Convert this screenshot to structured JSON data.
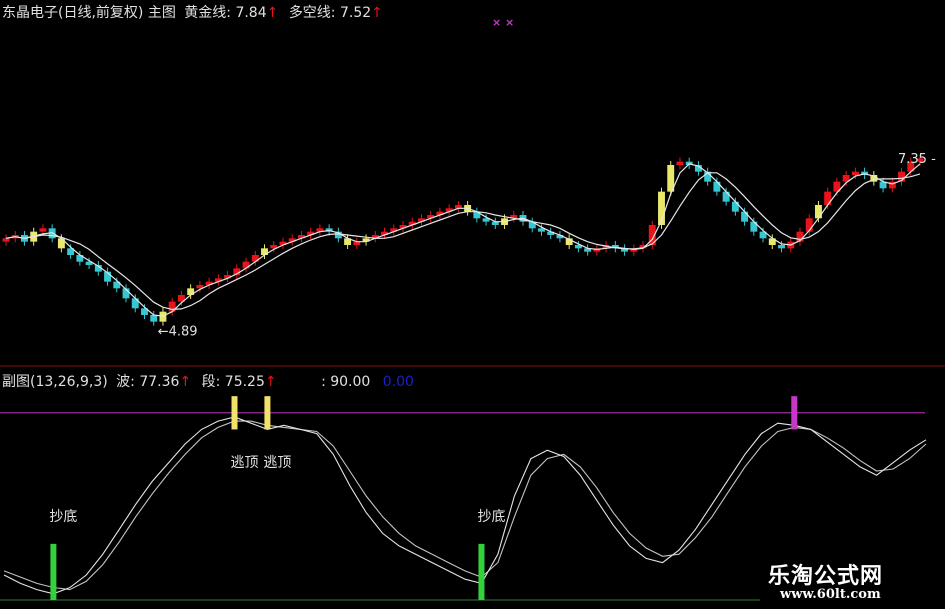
{
  "main_header": {
    "title": "东晶电子(日线,前复权)",
    "label": "主图",
    "gold_line_label": "黄金线:",
    "gold_line_value": "7.84",
    "longshort_label": "多空线:",
    "longshort_value": "7.52",
    "arrow": "↑"
  },
  "sub_header": {
    "title": "副图(13,26,9,3)",
    "wave_label": "波:",
    "wave_value": "77.36",
    "segment_label": "段:",
    "segment_value": "75.25",
    "level_text": ": 90.00",
    "blue_value": "0.00",
    "arrow": "↑"
  },
  "annotations": {
    "low_price": "4.89",
    "high_price": "7.35",
    "bottom_buy": "抄底",
    "escape_top": "逃顶"
  },
  "watermark": {
    "name": "乐淘公式网",
    "url": "www.60lt.com"
  },
  "colors": {
    "up": "#e8141a",
    "down": "#35c7d3",
    "neutral_yellow": "#e8e86a",
    "signal_buy": "#35d13a",
    "signal_sell": "#f2e26a",
    "signal_magenta": "#c838c8",
    "level_line": "#b030b0",
    "divider": "#8a1010",
    "curve": "#e6e6e6",
    "arrow": "#e8141a",
    "blue": "#1a20c8"
  },
  "chart_data": [
    {
      "type": "candlestick",
      "title": "东晶电子(日线,前复权)",
      "y_marks": {
        "low": 4.89,
        "high": 7.35
      },
      "series": [
        {
          "name": "黄金线",
          "last": 7.84
        },
        {
          "name": "多空线",
          "last": 7.52
        }
      ],
      "closes": [
        6.2,
        6.25,
        6.15,
        6.3,
        6.35,
        6.2,
        6.05,
        5.95,
        5.85,
        5.8,
        5.7,
        5.55,
        5.45,
        5.3,
        5.15,
        5.05,
        4.95,
        5.1,
        5.25,
        5.35,
        5.45,
        5.5,
        5.55,
        5.6,
        5.65,
        5.75,
        5.85,
        5.95,
        6.05,
        6.1,
        6.15,
        6.2,
        6.25,
        6.3,
        6.35,
        6.3,
        6.2,
        6.1,
        6.15,
        6.2,
        6.25,
        6.3,
        6.35,
        6.4,
        6.45,
        6.5,
        6.55,
        6.6,
        6.65,
        6.7,
        6.6,
        6.5,
        6.45,
        6.4,
        6.5,
        6.55,
        6.45,
        6.35,
        6.3,
        6.25,
        6.2,
        6.1,
        6.05,
        6.0,
        6.05,
        6.1,
        6.05,
        6.0,
        6.05,
        6.1,
        6.4,
        6.9,
        7.3,
        7.35,
        7.3,
        7.2,
        7.05,
        6.9,
        6.75,
        6.6,
        6.45,
        6.3,
        6.2,
        6.1,
        6.05,
        6.15,
        6.3,
        6.5,
        6.7,
        6.9,
        7.05,
        7.15,
        7.2,
        7.15,
        7.05,
        6.95,
        7.05,
        7.2,
        7.35,
        7.4
      ]
    },
    {
      "type": "line",
      "title": "副图(13,26,9,3)",
      "ylim": [
        0,
        100
      ],
      "levels": [
        90.0,
        0.0
      ],
      "series": [
        {
          "name": "波",
          "last": 77.36,
          "values": [
            12,
            8,
            5,
            3,
            6,
            12,
            22,
            34,
            46,
            57,
            66,
            75,
            82,
            86,
            88,
            85,
            82,
            84,
            82,
            80,
            70,
            55,
            42,
            32,
            26,
            22,
            18,
            14,
            10,
            8,
            22,
            50,
            68,
            72,
            69,
            60,
            48,
            36,
            26,
            20,
            18,
            24,
            34,
            46,
            58,
            70,
            80,
            85,
            84,
            82,
            76,
            70,
            64,
            60,
            66,
            72,
            77
          ]
        },
        {
          "name": "段",
          "last": 75.25,
          "values": [
            14,
            11,
            8,
            6,
            5,
            9,
            17,
            28,
            40,
            51,
            61,
            70,
            78,
            83,
            86,
            86,
            84,
            83,
            82,
            81,
            74,
            62,
            50,
            40,
            32,
            26,
            22,
            18,
            14,
            11,
            18,
            40,
            60,
            68,
            70,
            64,
            54,
            42,
            32,
            25,
            21,
            22,
            30,
            40,
            52,
            64,
            74,
            81,
            83,
            82,
            78,
            73,
            67,
            62,
            63,
            68,
            75
          ]
        }
      ],
      "signals": [
        {
          "type": "抄底",
          "index": 3
        },
        {
          "type": "逃顶",
          "index": 14
        },
        {
          "type": "逃顶",
          "index": 16
        },
        {
          "type": "抄底",
          "index": 29
        },
        {
          "type": "逃顶",
          "index": 48
        }
      ]
    }
  ]
}
